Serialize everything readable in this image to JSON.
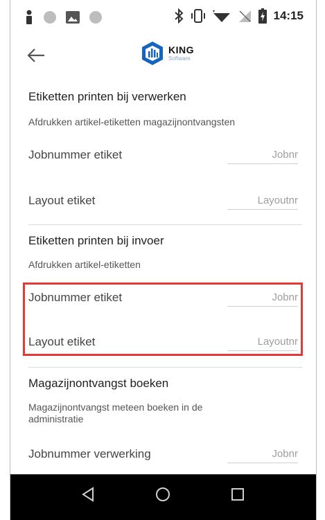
{
  "status_bar": {
    "time": "14:15"
  },
  "toolbar": {
    "logo_name": "KING",
    "logo_sub": "Software"
  },
  "sections": [
    {
      "title": "Etiketten printen bij verwerken",
      "description": "Afdrukken artikel-etiketten magazijnontvangsten",
      "rows": [
        {
          "label": "Jobnummer etiket",
          "placeholder": "Jobnr"
        },
        {
          "label": "Layout etiket",
          "placeholder": "Layoutnr"
        }
      ]
    },
    {
      "title": "Etiketten printen bij invoer",
      "description": "Afdrukken artikel-etiketten",
      "rows": [
        {
          "label": "Jobnummer etiket",
          "placeholder": "Jobnr"
        },
        {
          "label": "Layout etiket",
          "placeholder": "Layoutnr"
        }
      ]
    },
    {
      "title": "Magazijnontvangst boeken",
      "description": "Magazijnontvangst meteen boeken in de administratie",
      "rows": [
        {
          "label": "Jobnummer verwerking",
          "placeholder": "Jobnr"
        }
      ]
    }
  ],
  "colors": {
    "highlight": "#e53935",
    "logo_blue": "#1565c0",
    "navbar": "#000000"
  }
}
